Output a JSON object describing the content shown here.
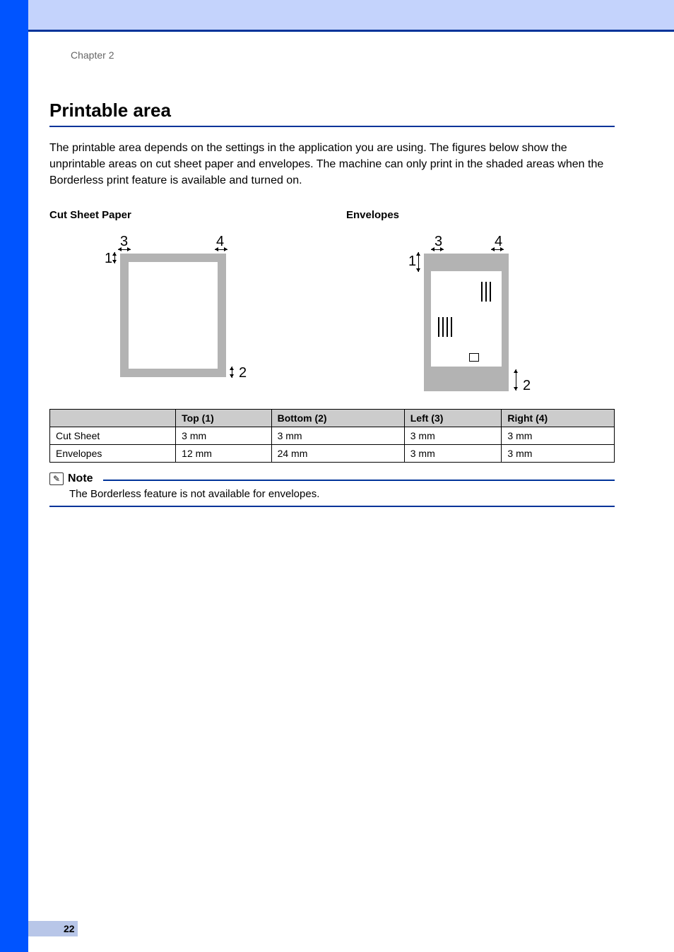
{
  "chapter": "Chapter 2",
  "heading": "Printable area",
  "intro": "The printable area depends on the settings in the application you are using. The figures below show the unprintable areas on cut sheet paper and envelopes. The machine can only print in the shaded areas when the Borderless print feature is available and turned on.",
  "diagrams": {
    "cut_sheet_title": "Cut Sheet Paper",
    "envelopes_title": "Envelopes",
    "labels": {
      "l1": "1",
      "l2": "2",
      "l3": "3",
      "l4": "4"
    }
  },
  "table": {
    "headers": {
      "c0": "",
      "c1": "Top (1)",
      "c2": "Bottom (2)",
      "c3": "Left (3)",
      "c4": "Right (4)"
    },
    "rows": [
      {
        "name": "Cut Sheet",
        "top": "3 mm",
        "bottom": "3 mm",
        "left": "3 mm",
        "right": "3 mm"
      },
      {
        "name": "Envelopes",
        "top": "12 mm",
        "bottom": "24 mm",
        "left": "3 mm",
        "right": "3 mm"
      }
    ]
  },
  "note": {
    "title": "Note",
    "body": "The Borderless feature is not available for envelopes."
  },
  "page_number": "22"
}
